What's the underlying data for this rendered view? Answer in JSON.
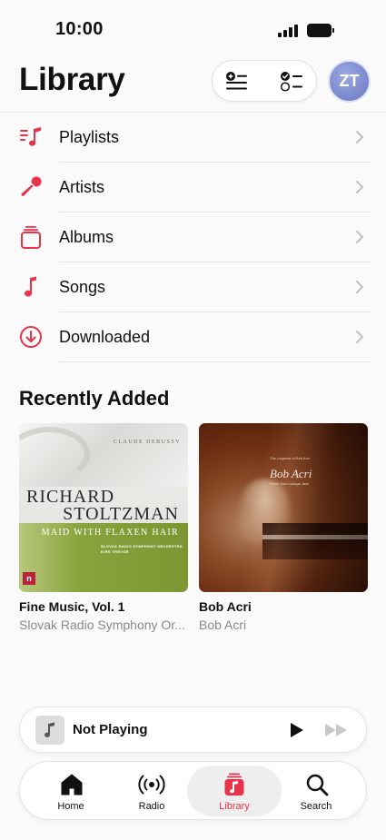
{
  "status_bar": {
    "time": "10:00"
  },
  "header": {
    "title": "Library",
    "avatar_initials": "ZT"
  },
  "menu": {
    "items": [
      {
        "label": "Playlists",
        "icon": "playlist-icon"
      },
      {
        "label": "Artists",
        "icon": "microphone-icon"
      },
      {
        "label": "Albums",
        "icon": "album-stack-icon"
      },
      {
        "label": "Songs",
        "icon": "music-note-icon"
      },
      {
        "label": "Downloaded",
        "icon": "download-circle-icon"
      }
    ]
  },
  "recently_added": {
    "title": "Recently Added",
    "albums": [
      {
        "title": "Fine Music, Vol. 1",
        "artist": "Slovak Radio Symphony Or...",
        "art": {
          "composer": "CLAUDE DEBUSSY",
          "line1": "RICHARD",
          "line2": "STOLTZMAN",
          "subtitle": "MAID WITH FLAXEN HAIR",
          "small1": "SLOVAK RADIO SYMPHONY ORCHESTRA",
          "small2": "KIRK TREVOR",
          "logo": "n"
        }
      },
      {
        "title": "Bob Acri",
        "artist": "Bob Acri",
        "art": {
          "name": "Bob Acri",
          "caption1": "The Legends of Bob Acri",
          "caption2": "Piano Solo Lounge Jazz"
        }
      }
    ]
  },
  "mini_player": {
    "title": "Not Playing"
  },
  "tab_bar": {
    "tabs": [
      {
        "label": "Home",
        "icon": "home-icon",
        "active": false
      },
      {
        "label": "Radio",
        "icon": "radio-icon",
        "active": false
      },
      {
        "label": "Library",
        "icon": "library-icon",
        "active": true
      },
      {
        "label": "Search",
        "icon": "search-icon",
        "active": false
      }
    ]
  },
  "colors": {
    "accent": "#e8334a",
    "background": "#fafafa"
  }
}
